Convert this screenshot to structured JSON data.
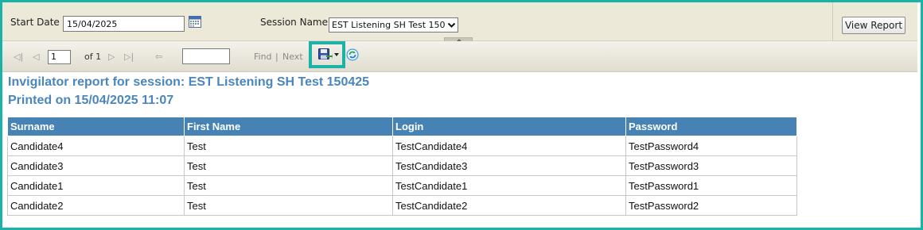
{
  "params": {
    "start_date_label": "Start Date",
    "start_date_value": "15/04/2025",
    "session_name_label": "Session Name",
    "session_name_value": "EST Listening SH Test 150",
    "view_report_label": "View Report"
  },
  "toolbar": {
    "first_glyph": "◁|",
    "prev_glyph": "◁",
    "page_value": "1",
    "of_text": "of 1",
    "next_glyph": "▷",
    "last_glyph": "▷|",
    "back_glyph": "⇦",
    "find_label": "Find",
    "separator": "|",
    "next_label": "Next",
    "export_icon": "save-disk-icon",
    "refresh_icon": "refresh-icon"
  },
  "report": {
    "title": "Invigilator report for session: EST Listening SH Test 150425",
    "printed": "Printed on 15/04/2025 11:07",
    "columns": [
      "Surname",
      "First Name",
      "Login",
      "Password"
    ],
    "rows": [
      [
        "Candidate4",
        "Test",
        "TestCandidate4",
        "TestPassword4"
      ],
      [
        "Candidate3",
        "Test",
        "TestCandidate3",
        "TestPassword3"
      ],
      [
        "Candidate1",
        "Test",
        "TestCandidate1",
        "TestPassword1"
      ],
      [
        "Candidate2",
        "Test",
        "TestCandidate2",
        "TestPassword2"
      ]
    ]
  },
  "colors": {
    "header_bg": "#4682b4",
    "title_color": "#4a86bd",
    "highlight": "#1bb3a8"
  }
}
